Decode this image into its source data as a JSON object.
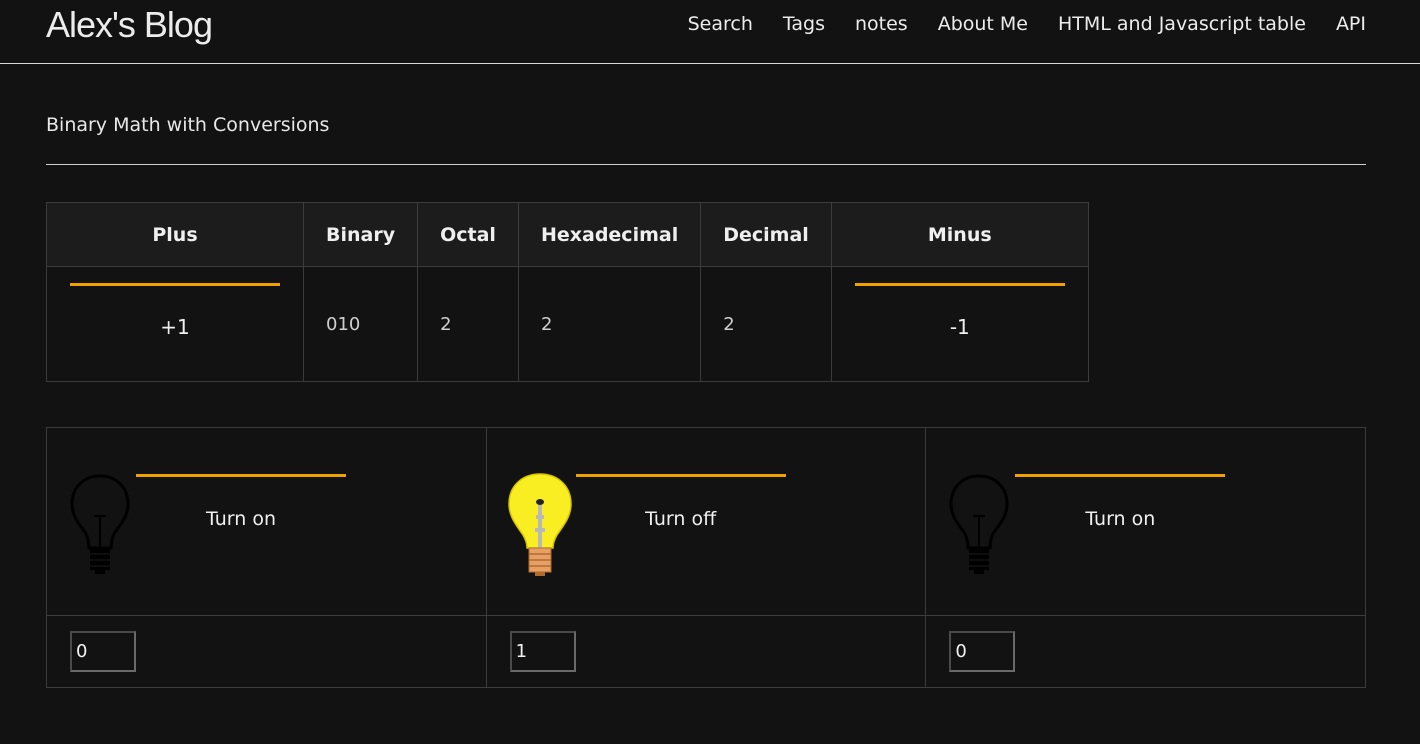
{
  "site": {
    "title": "Alex's Blog",
    "nav": [
      "Search",
      "Tags",
      "notes",
      "About Me",
      "HTML and Javascript table",
      "API"
    ]
  },
  "page": {
    "heading": "Binary Math with Conversions"
  },
  "converter": {
    "headers": {
      "plus": "Plus",
      "binary": "Binary",
      "octal": "Octal",
      "hex": "Hexadecimal",
      "decimal": "Decimal",
      "minus": "Minus"
    },
    "values": {
      "plus": "+1",
      "binary": "010",
      "octal": "2",
      "hex": "2",
      "decimal": "2",
      "minus": "-1"
    }
  },
  "bits": [
    {
      "button": "Turn on",
      "value": "0",
      "bulb": "bulb-off-icon"
    },
    {
      "button": "Turn off",
      "value": "1",
      "bulb": "bulb-on-icon"
    },
    {
      "button": "Turn on",
      "value": "0",
      "bulb": "bulb-off-icon"
    }
  ],
  "colors": {
    "background": "#121212",
    "accent": "#f0a000",
    "bulb_on": "#f8ee22"
  }
}
